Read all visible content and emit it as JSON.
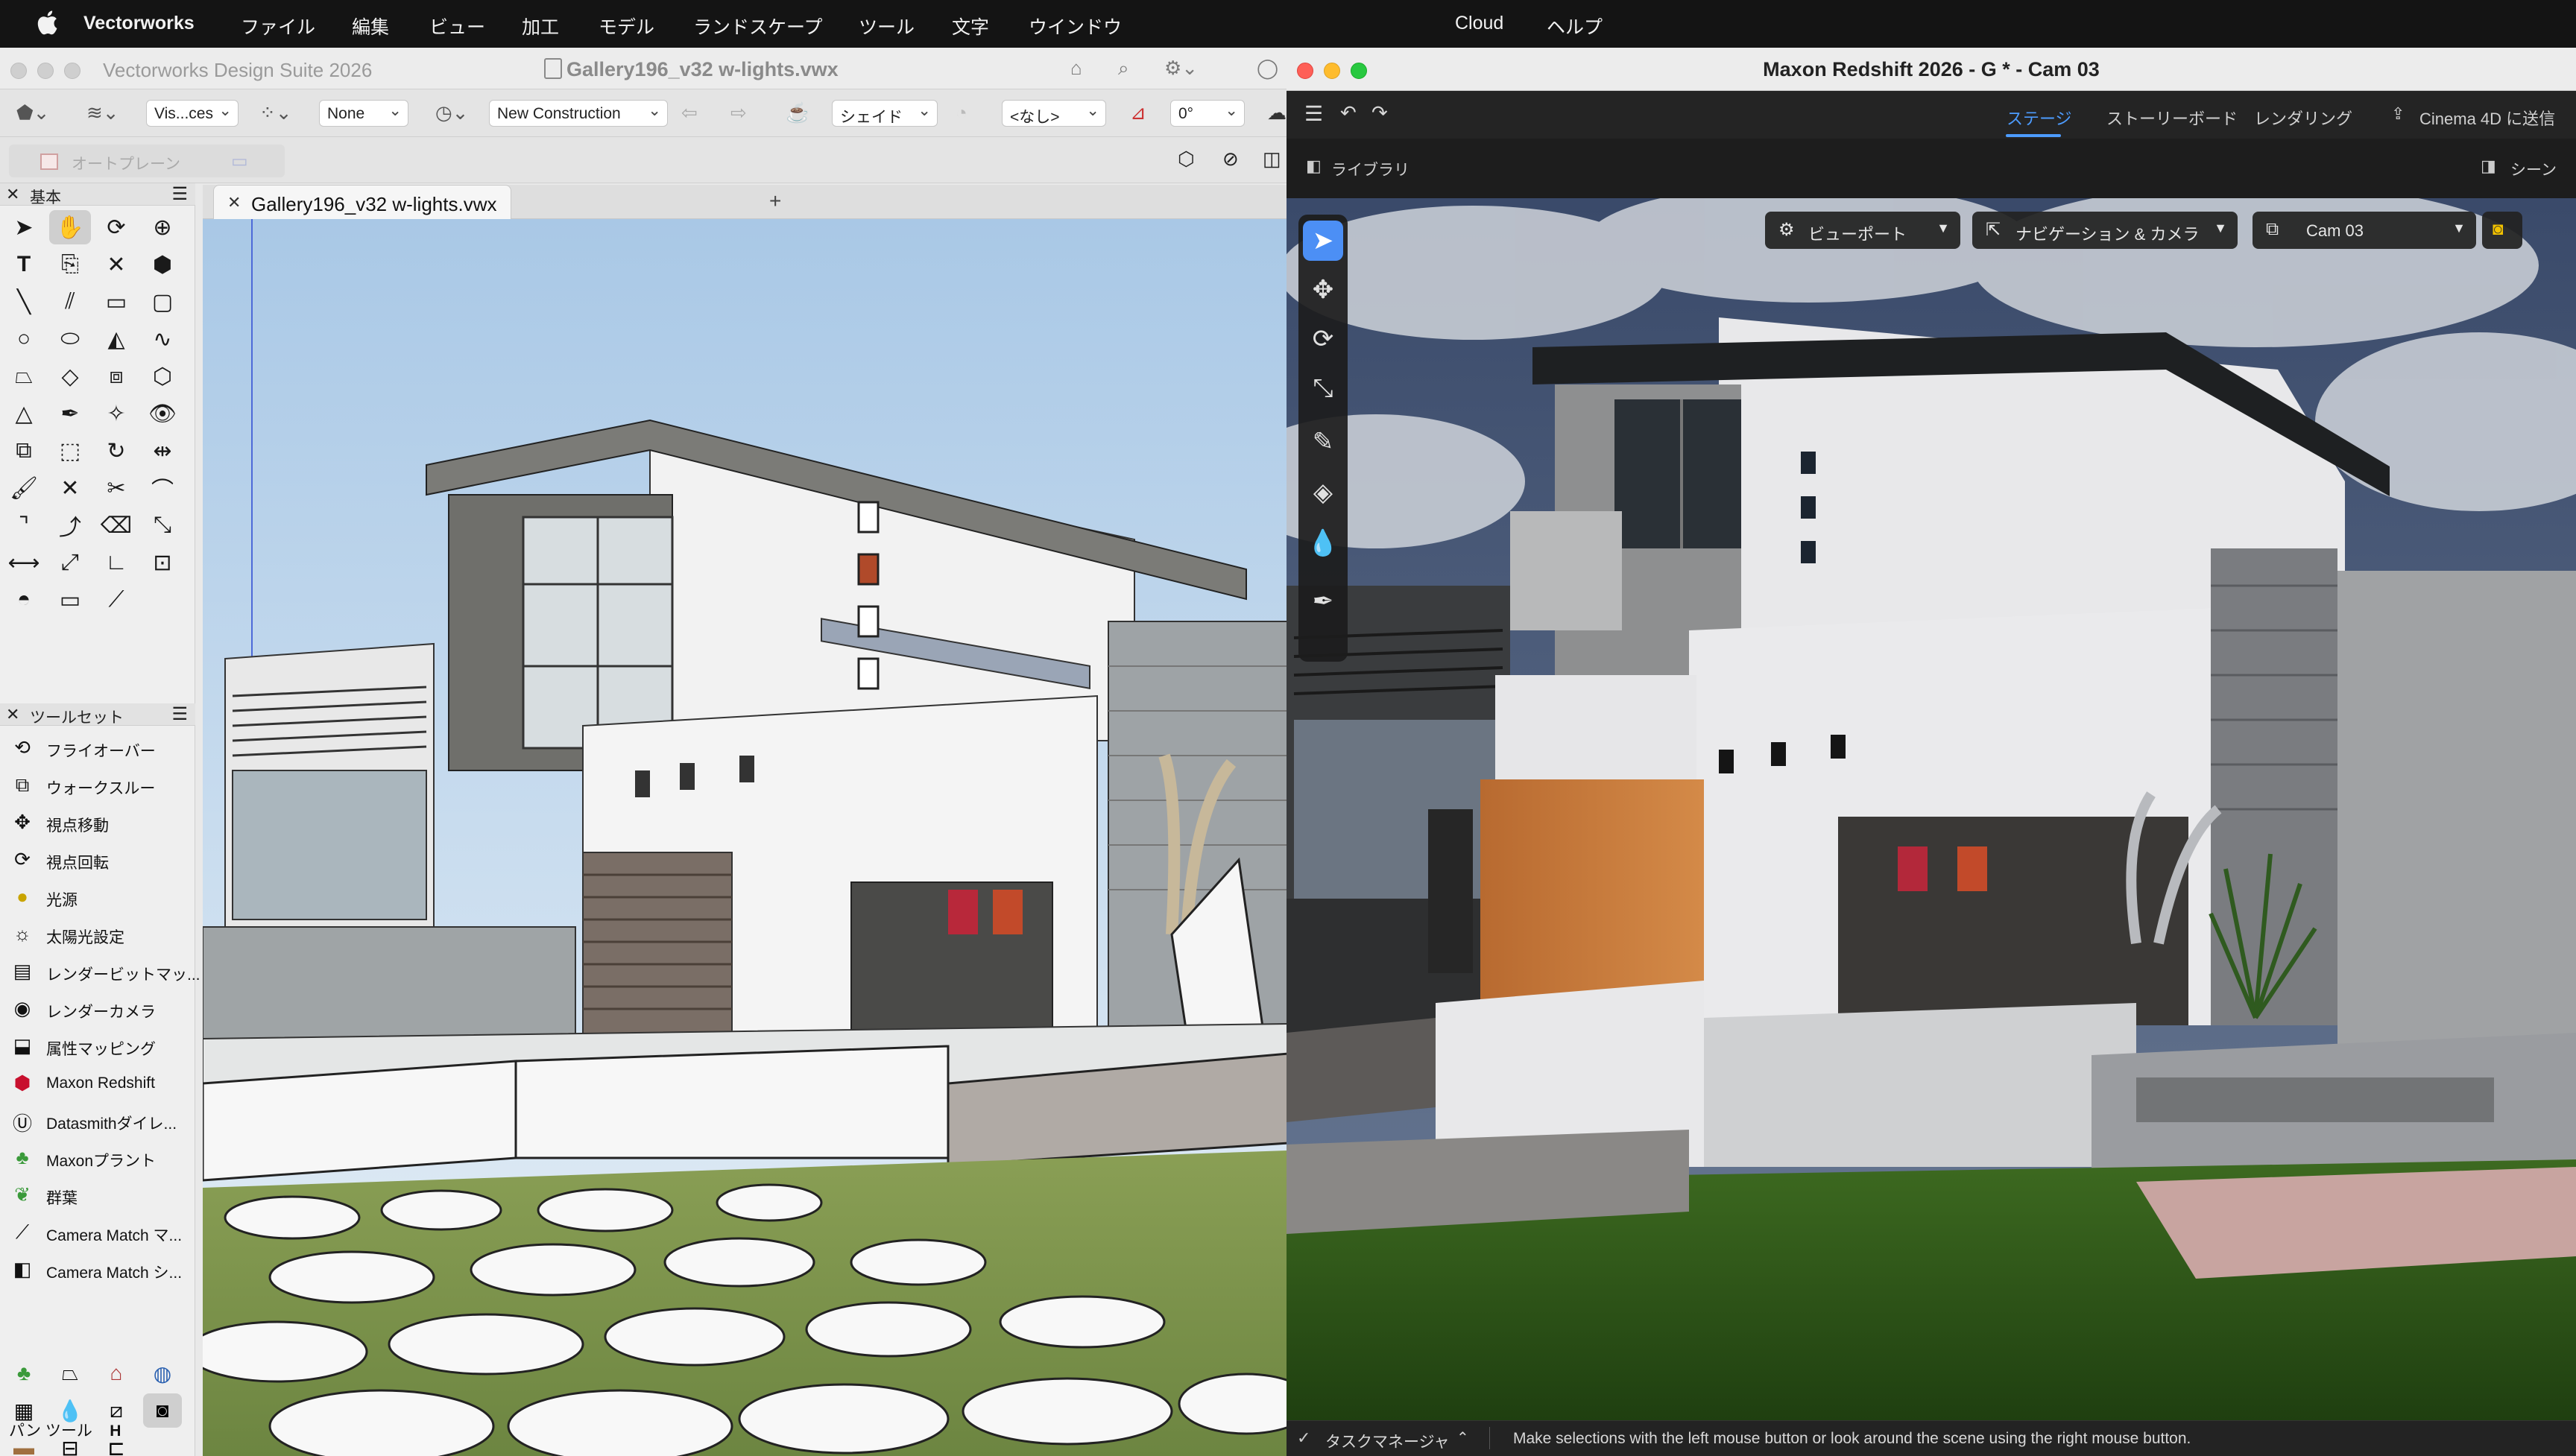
{
  "menubar": {
    "app_name": "Vectorworks",
    "items": [
      "ファイル",
      "編集",
      "ビュー",
      "加工",
      "モデル",
      "ランドスケープ",
      "ツール",
      "文字",
      "ウインドウ"
    ],
    "cloud": "Cloud",
    "help": "ヘルプ"
  },
  "vw": {
    "app_title": "Vectorworks Design Suite 2026",
    "doc_title": "Gallery196_v32 w-lights.vwx",
    "toolbar": {
      "class_dd": "Vis...ces",
      "view_dd": "None",
      "layer_dd": "New Construction",
      "render_dd": "シェイド",
      "lighting_dd": "<なし>",
      "angle_value": "0°"
    },
    "plane_label": "オートプレーン",
    "palette_basic_title": "基本",
    "palette_toolset_title": "ツールセット",
    "toolset": [
      {
        "label": "フライオーバー",
        "icon": "flyover-icon"
      },
      {
        "label": "ウォークスルー",
        "icon": "walkthrough-icon"
      },
      {
        "label": "視点移動",
        "icon": "translate-view-icon"
      },
      {
        "label": "視点回転",
        "icon": "rotate-view-icon"
      },
      {
        "label": "光源",
        "icon": "light-bulb-icon"
      },
      {
        "label": "太陽光設定",
        "icon": "sun-icon"
      },
      {
        "label": "レンダービットマッ...",
        "icon": "render-bitmap-icon"
      },
      {
        "label": "レンダーカメラ",
        "icon": "render-camera-icon"
      },
      {
        "label": "属性マッピング",
        "icon": "attribute-mapping-icon"
      },
      {
        "label": "Maxon Redshift",
        "icon": "redshift-cube-icon"
      },
      {
        "label": "Datasmithダイレ...",
        "icon": "datasmith-icon"
      },
      {
        "label": "Maxonプラント",
        "icon": "plant-icon"
      },
      {
        "label": "群葉",
        "icon": "foliage-icon"
      },
      {
        "label": "Camera Match マ...",
        "icon": "camera-match-icon"
      },
      {
        "label": "Camera Match シ...",
        "icon": "camera-match-2-icon"
      }
    ],
    "tab_title": "Gallery196_v32 w-lights.vwx",
    "status_tool": "パン ツール",
    "status_key": "H"
  },
  "rs": {
    "title": "Maxon Redshift 2026 - G * - Cam 03",
    "tabs": [
      "ステージ",
      "ストーリーボード",
      "レンダリング"
    ],
    "active_tab": "ステージ",
    "send_to_c4d": "Cinema 4D に送信",
    "library": "ライブラリ",
    "scene": "シーン",
    "viewport_dd": "ビューポート",
    "nav_dd": "ナビゲーション & カメラ",
    "camera_dd": "Cam 03",
    "task_manager": "タスクマネージャ",
    "status_msg": "Make selections with the left mouse button or look around the scene using the right mouse button."
  },
  "colors": {
    "accent_blue": "#4c8ff5",
    "redshift_red": "#c8102e",
    "camera_yellow": "#f2c200"
  }
}
